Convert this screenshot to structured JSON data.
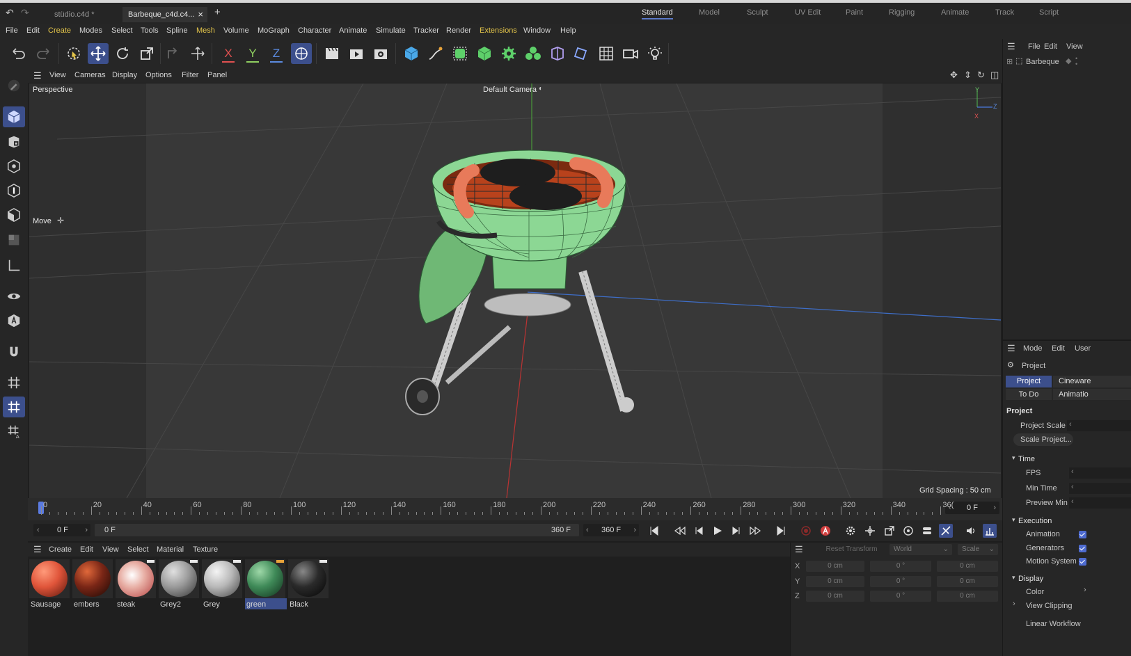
{
  "titlebar": {
    "tabs": [
      {
        "label": "stüdio.c4d *"
      },
      {
        "label": "Barbeque_c4d.c4..."
      }
    ],
    "close_glyph": "×",
    "new_tab_glyph": "+",
    "layouts": [
      "Standard",
      "Model",
      "Sculpt",
      "UV Edit",
      "Paint",
      "Rigging",
      "Animate",
      "Track",
      "Script"
    ],
    "active_layout": "Standard"
  },
  "menubar": [
    "File",
    "Edit",
    "Create",
    "Modes",
    "Select",
    "Tools",
    "Spline",
    "Mesh",
    "Volume",
    "MoGraph",
    "Character",
    "Animate",
    "Simulate",
    "Tracker",
    "Render",
    "Extensions",
    "Window",
    "Help"
  ],
  "toolbar": {
    "axis_x": "X",
    "axis_y": "Y",
    "axis_z": "Z"
  },
  "viewport": {
    "menu": [
      "View",
      "Cameras",
      "Display",
      "Options",
      "Filter",
      "Panel"
    ],
    "view_name": "Perspective",
    "camera_label": "Default Camera",
    "tool_label": "Move",
    "grid_spacing": "Grid Spacing : 50 cm",
    "axis_labels": {
      "y": "Y",
      "z": "Z",
      "x": "X"
    }
  },
  "timeline": {
    "ticks": [
      "0",
      "20",
      "40",
      "60",
      "80",
      "100",
      "120",
      "140",
      "160",
      "180",
      "200",
      "220",
      "240",
      "260",
      "280",
      "300",
      "320",
      "340",
      "36("
    ],
    "current_frame": "0 F"
  },
  "transport": {
    "start_frame": "0 F",
    "preview_start": "0 F",
    "preview_end": "360 F",
    "end_frame": "360 F"
  },
  "materials": {
    "menu": [
      "Create",
      "Edit",
      "View",
      "Select",
      "Material",
      "Texture"
    ],
    "items": [
      {
        "name": "Sausage",
        "color": "#e0553a"
      },
      {
        "name": "embers",
        "color": "#7a2616"
      },
      {
        "name": "steak",
        "color": "#e8b0a6"
      },
      {
        "name": "Grey2",
        "color": "#9a9a9a"
      },
      {
        "name": "Grey",
        "color": "#b8b8b8"
      },
      {
        "name": "green",
        "color": "#3f8a58"
      },
      {
        "name": "Black",
        "color": "#2a2a2a"
      }
    ],
    "selected": "green"
  },
  "coordinates": {
    "reset_label": "Reset Transform",
    "space": "World",
    "mode": "Scale",
    "rows": [
      {
        "axis": "X",
        "pos": "0 cm",
        "rot": "0 °",
        "scale": "0 cm"
      },
      {
        "axis": "Y",
        "pos": "0 cm",
        "rot": "0 °",
        "scale": "0 cm"
      },
      {
        "axis": "Z",
        "pos": "0 cm",
        "rot": "0 °",
        "scale": "0 cm"
      }
    ]
  },
  "object_manager": {
    "menu": [
      "File",
      "Edit",
      "View"
    ],
    "object_name": "Barbeque"
  },
  "attributes": {
    "menu": [
      "Mode",
      "Edit",
      "User"
    ],
    "title": "Project",
    "tabs": [
      "Project",
      "Cineware"
    ],
    "subtabs": [
      "To Do",
      "Animatio"
    ],
    "section_project": "Project",
    "project_scale_label": "Project Scale",
    "scale_project_button": "Scale Project...",
    "section_time": "Time",
    "fps_label": "FPS",
    "min_time_label": "Min Time",
    "preview_min_label": "Preview Min",
    "section_execution": "Execution",
    "animation_label": "Animation",
    "generators_label": "Generators",
    "motion_system_label": "Motion System",
    "section_display": "Display",
    "color_label": "Color",
    "view_clipping_label": "View Clipping",
    "linear_workflow_label": "Linear Workflow"
  }
}
